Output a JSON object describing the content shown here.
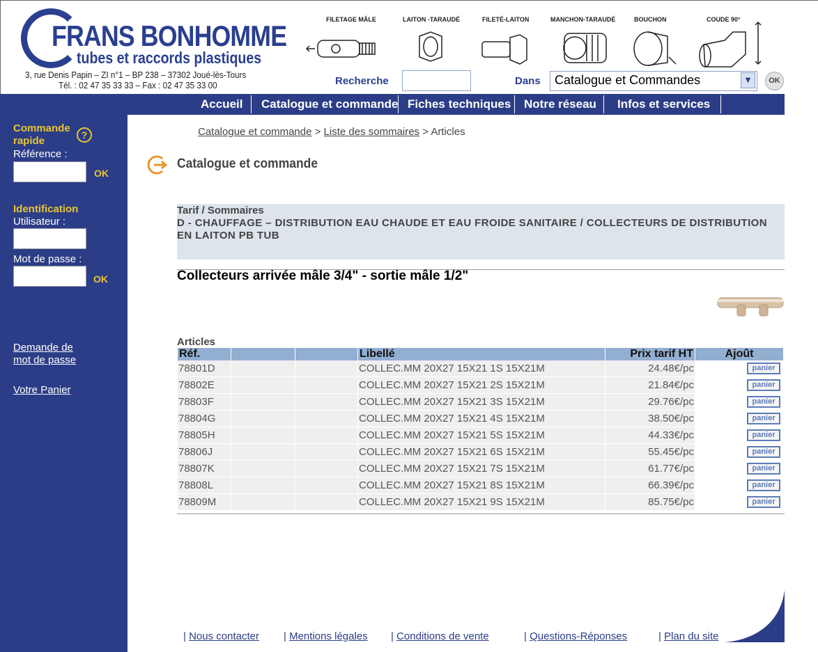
{
  "brand": {
    "name": "FRANS BONHOMME",
    "tagline": "tubes et raccords plastiques",
    "address": "3, rue Denis Papin – ZI n°1 – BP 238 – 37302 Joué-lès-Tours",
    "phone": "Tél. : 02 47 35 33 33 – Fax : 02 47 35 33 00"
  },
  "fittings": {
    "labels": [
      "FILETAGE MÂLE",
      "LAITON -TARAUDÉ",
      "FILETÉ-LAITON",
      "MANCHON-TARAUDÉ",
      "BOUCHON",
      "COUDE 90°"
    ]
  },
  "search": {
    "label": "Recherche",
    "value": "",
    "dans_label": "Dans",
    "dans_selected": "Catalogue et Commandes",
    "ok_label": "OK"
  },
  "nav": {
    "items": [
      "Accueil",
      "Catalogue et commande",
      "Fiches techniques",
      "Notre réseau",
      "Infos et services"
    ]
  },
  "sidebar": {
    "quick_order_title_1": "Commande",
    "quick_order_title_2": "rapide",
    "help_glyph": "?",
    "reference_label": "Référence :",
    "reference_value": "",
    "ok_label": "OK",
    "identification_title": "Identification",
    "user_label": "Utilisateur :",
    "password_label": "Mot de passe :",
    "password_request_1": "Demande de",
    "password_request_2": "mot de passe",
    "cart_link": "Votre Panier"
  },
  "breadcrumb": {
    "items": [
      "Catalogue et commande",
      "Liste des sommaires",
      "Articles"
    ],
    "separator": ">"
  },
  "section": {
    "title": "Catalogue et commande"
  },
  "tarif": {
    "title": "Tarif / Sommaires",
    "path": "D - CHAUFFAGE – DISTRIBUTION EAU CHAUDE ET EAU FROIDE SANITAIRE / COLLECTEURS DE DISTRIBUTION EN LAITON PB TUB"
  },
  "product": {
    "title": "Collecteurs arrivée mâle 3/4\" - sortie mâle 1/2\""
  },
  "articles": {
    "caption": "Articles",
    "headers": [
      "Réf.",
      "",
      "",
      "Libellé",
      "Prix tarif HT",
      "Ajoût"
    ],
    "button_label": "panier",
    "rows": [
      {
        "ref": "78801D",
        "label": "COLLEC.MM 20X27 15X21 1S 15X21M",
        "price": "24.48€/pc"
      },
      {
        "ref": "78802E",
        "label": "COLLEC.MM 20X27 15X21 2S 15X21M",
        "price": "21.84€/pc"
      },
      {
        "ref": "78803F",
        "label": "COLLEC.MM 20X27 15X21 3S 15X21M",
        "price": "29.76€/pc"
      },
      {
        "ref": "78804G",
        "label": "COLLEC.MM 20X27 15X21 4S 15X21M",
        "price": "38.50€/pc"
      },
      {
        "ref": "78805H",
        "label": "COLLEC.MM 20X27 15X21 5S 15X21M",
        "price": "44.33€/pc"
      },
      {
        "ref": "78806J",
        "label": "COLLEC.MM 20X27 15X21 6S 15X21M",
        "price": "55.45€/pc"
      },
      {
        "ref": "78807K",
        "label": "COLLEC.MM 20X27 15X21 7S 15X21M",
        "price": "61.77€/pc"
      },
      {
        "ref": "78808L",
        "label": "COLLEC.MM 20X27 15X21 8S 15X21M",
        "price": "66.39€/pc"
      },
      {
        "ref": "78809M",
        "label": "COLLEC.MM 20X27 15X21 9S 15X21M",
        "price": "85.75€/pc"
      }
    ]
  },
  "footer": {
    "separator": "|",
    "links": [
      "Nous contacter",
      "Mentions légales",
      "Conditions de vente",
      "Questions-Réponses",
      "Plan du site"
    ]
  },
  "colors": {
    "brand_blue": "#2c3d87",
    "accent_yellow": "#e8c531",
    "header_cell": "#92aed0",
    "tarif_bg": "#dde4ec"
  }
}
